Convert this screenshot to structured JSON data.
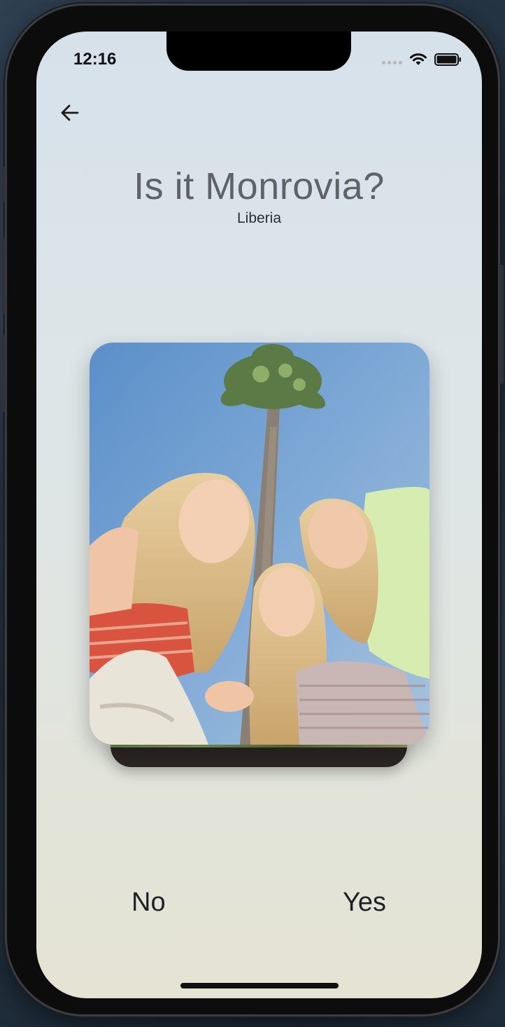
{
  "status_bar": {
    "time": "12:16",
    "icons": [
      "signal-dots-icon",
      "wifi-icon",
      "battery-icon"
    ]
  },
  "header": {
    "back_icon": "arrow-left-icon"
  },
  "question": {
    "title": "Is it Monrovia?",
    "subtitle": "Liberia"
  },
  "card": {
    "image": "photo of three smiling young women under a palm tree"
  },
  "answers": {
    "no_label": "No",
    "yes_label": "Yes"
  }
}
